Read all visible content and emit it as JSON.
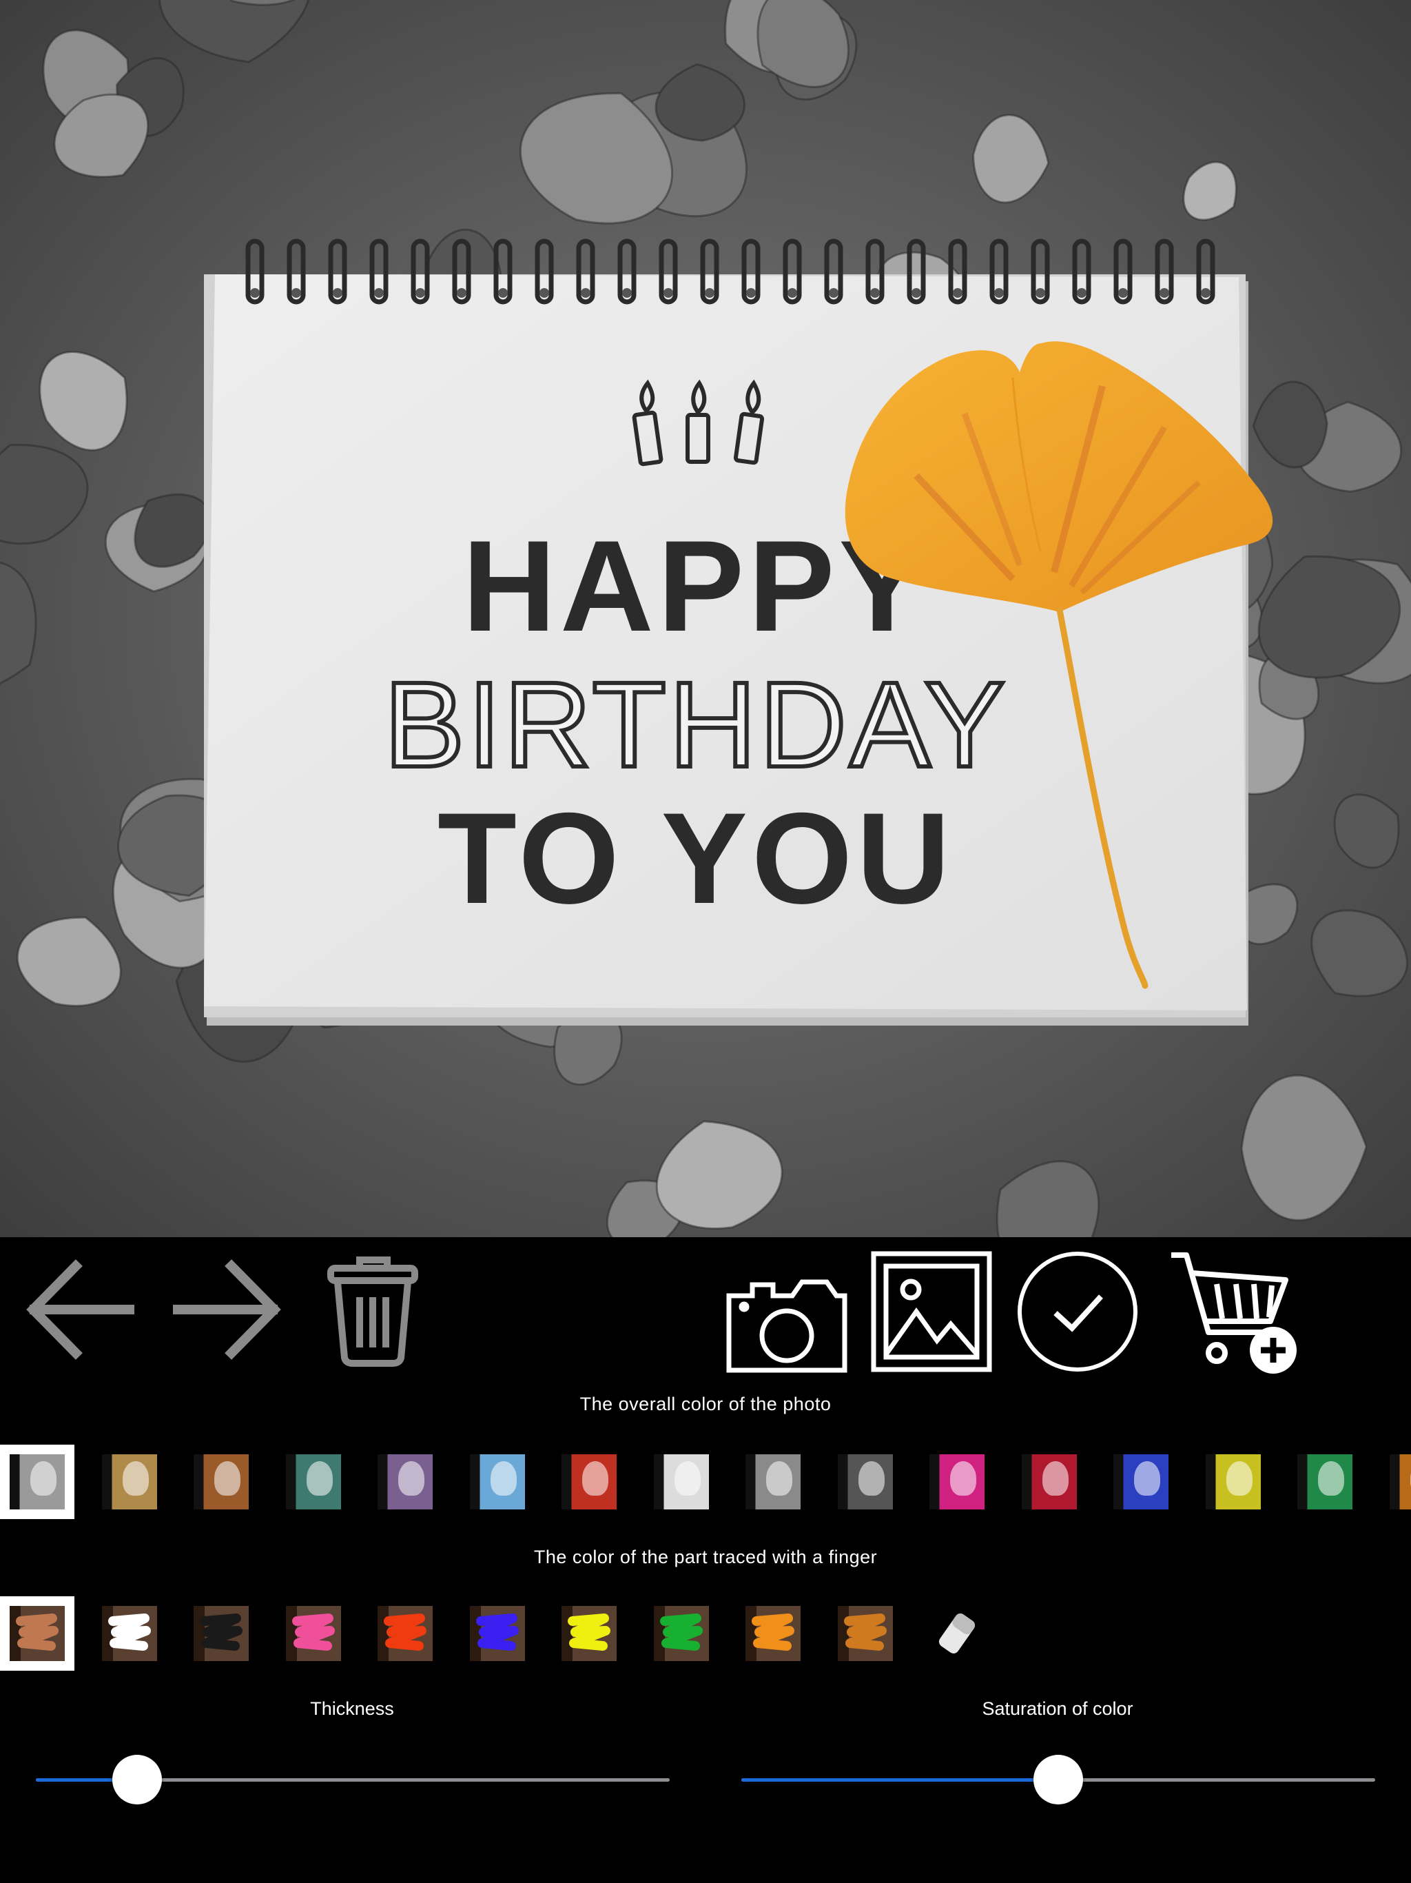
{
  "photo": {
    "card_lines": [
      "HAPPY",
      "BIRTHDAY",
      "TO YOU"
    ]
  },
  "toolbar": {
    "back": "arrow-left-icon",
    "forward": "arrow-right-icon",
    "delete": "trash-icon",
    "camera": "camera-icon",
    "library": "photo-library-icon",
    "done": "checkmark-icon",
    "shop": "cart-plus-icon"
  },
  "overall": {
    "label": "The overall color of the photo",
    "selected_index": 0,
    "filters": [
      {
        "name": "original-mono",
        "tint": "#9a9a9a"
      },
      {
        "name": "sepia",
        "tint": "#b08a4a"
      },
      {
        "name": "warm-brown",
        "tint": "#9a5a2a"
      },
      {
        "name": "teal",
        "tint": "#3f7a70"
      },
      {
        "name": "purple-fade",
        "tint": "#7a6090"
      },
      {
        "name": "blue-light",
        "tint": "#6aa8d8"
      },
      {
        "name": "red-noise",
        "tint": "#c03020"
      },
      {
        "name": "sketch",
        "tint": "#dcdcdc"
      },
      {
        "name": "gray",
        "tint": "#8a8a8a"
      },
      {
        "name": "dark-mono",
        "tint": "#555555"
      },
      {
        "name": "magenta",
        "tint": "#d02080"
      },
      {
        "name": "crimson",
        "tint": "#b01830"
      },
      {
        "name": "blue",
        "tint": "#2a40c0"
      },
      {
        "name": "yellow",
        "tint": "#c8c020"
      },
      {
        "name": "green",
        "tint": "#208848"
      },
      {
        "name": "amber",
        "tint": "#b86a18"
      }
    ]
  },
  "traced": {
    "label": "The color of the part traced with a finger",
    "selected_index": 0,
    "brushes": [
      {
        "name": "original",
        "color": "#c07850"
      },
      {
        "name": "white",
        "color": "#ffffff"
      },
      {
        "name": "black",
        "color": "#1a1a1a"
      },
      {
        "name": "pink",
        "color": "#f0509a"
      },
      {
        "name": "red-orange",
        "color": "#f03a10"
      },
      {
        "name": "blue",
        "color": "#3a20f0"
      },
      {
        "name": "yellow",
        "color": "#f0f010"
      },
      {
        "name": "green",
        "color": "#18b030"
      },
      {
        "name": "orange",
        "color": "#f0901a"
      },
      {
        "name": "amber",
        "color": "#d07a20"
      }
    ],
    "eraser": "eraser-icon"
  },
  "thickness": {
    "label": "Thickness",
    "value": 0.16
  },
  "saturation": {
    "label": "Saturation of color",
    "value": 0.5
  },
  "colors": {
    "accent": "#1a6bd8",
    "track": "#8e8e93",
    "leaf": "#f2a62a"
  }
}
